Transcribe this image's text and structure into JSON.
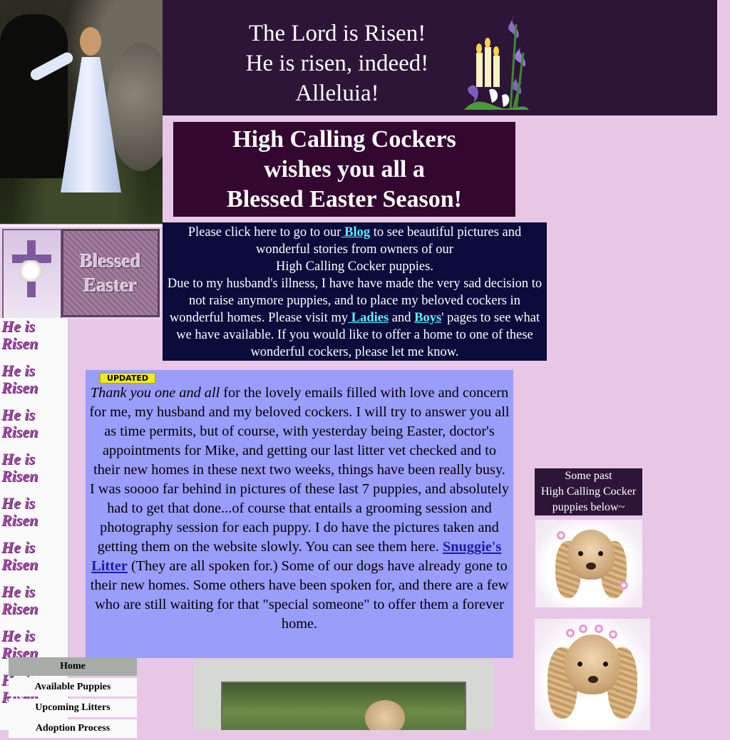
{
  "header": {
    "lines": [
      "The Lord is Risen!",
      "He is risen, indeed!",
      "Alleluia!"
    ]
  },
  "greeting": {
    "lines": [
      "High Calling Cockers",
      "wishes you all a",
      "Blessed Easter Season!"
    ]
  },
  "blessed_easter_graphic": {
    "line1": "Blessed",
    "line2": "Easter"
  },
  "risen_strip": {
    "tile_text_1": "He is",
    "tile_text_2": "Risen"
  },
  "info": {
    "p1_prefix": "Please click here to go to our",
    "blog_link": " Blog",
    "p1_suffix": " to see beautiful pictures and wonderful stories from owners of our",
    "p1_line3": "High Calling Cocker puppies.",
    "p2_prefix": "Due to my husband's illness, I have have made the very sad decision to not raise anymore puppies, and to place my beloved cockers in wonderful homes.  Please visit my",
    "ladies_link": " Ladies",
    "p2_and": " and ",
    "boys_link": "Boys",
    "p2_suffix": "' pages to see what we have available.  If you would like to offer a home to one of these wonderful cockers, please let me know."
  },
  "updates": {
    "badge": "UPDATED",
    "p1_italic": "Thank you one and all",
    "p1_rest": " for the lovely emails filled with love and concern for me, my  husband and my beloved cockers.  I will try to answer you all as time permits, but of course, with yesterday being Easter, doctor's appointments for Mike, and getting our last litter vet checked and to their new homes in these next two weeks, things have been really busy.",
    "p2_prefix": "I was soooo far behind in pictures of these last 7 puppies, and absolutely had to get that done...of course that entails a grooming session and photography session for each puppy. I do have the pictures taken and getting them on the website slowly. You can see them here.  ",
    "snuggie_link": "Snuggie's Litter",
    "p2_suffix": "  (They are all spoken for.)   Some of our dogs have already gone to their new homes.  Some others have been spoken for, and there are a few who are still waiting for that \"special someone\" to offer them a forever home."
  },
  "past_puppies": {
    "lines": [
      "Some past",
      "High Calling Cocker",
      "puppies below~"
    ]
  },
  "nav": {
    "items": [
      {
        "label": "Home",
        "active": true
      },
      {
        "label": "Available Puppies",
        "active": false
      },
      {
        "label": "Upcoming Litters",
        "active": false
      },
      {
        "label": "Adoption Process",
        "active": false
      }
    ]
  },
  "colors": {
    "background": "#e8c7e6",
    "header_bg": "#2d1538",
    "greeting_bg": "#33072f",
    "info_bg": "#0b0b3c",
    "updates_bg": "#9a9dfa",
    "link_cyan": "#58f0ff",
    "link_blue": "#1a1aa8",
    "badge_yellow": "#f2ea1c"
  }
}
